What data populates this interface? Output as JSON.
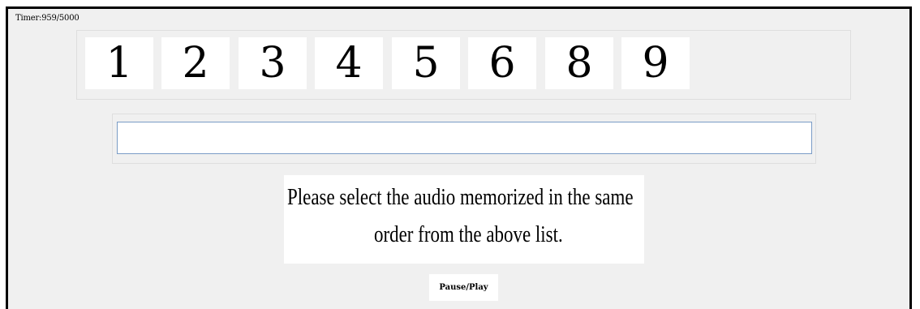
{
  "timer": {
    "label": "Timer:959/5000"
  },
  "digits": [
    "1",
    "2",
    "3",
    "4",
    "5",
    "6",
    "8",
    "9"
  ],
  "answer_input": {
    "value": "",
    "placeholder": ""
  },
  "instruction": {
    "line1": "Please select the audio memorized in the same",
    "line2": "order from the above list."
  },
  "controls": {
    "pause_play_label": "Pause/Play"
  }
}
